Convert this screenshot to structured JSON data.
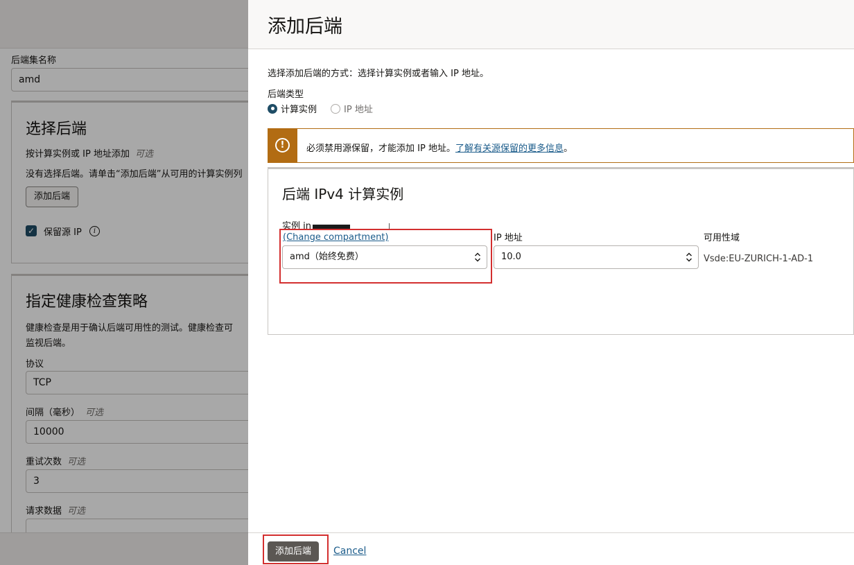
{
  "background": {
    "backend_set_name_label": "后端集名称",
    "backend_set_name_value": "amd",
    "select_backends": {
      "title": "选择后端",
      "add_by_label": "按计算实例或 IP 地址添加",
      "optional": "可选",
      "empty_text": "没有选择后端。请单击“添加后端”从可用的计算实例列",
      "add_button": "添加后端",
      "preserve_source_ip_label": "保留源 IP"
    },
    "health_check": {
      "title": "指定健康检查策略",
      "description_line1": "健康检查是用于确认后端可用性的测试。健康检查可",
      "description_line2": "监视后端。",
      "protocol_label": "协议",
      "protocol_value": "TCP",
      "interval_label": "间隔（毫秒）",
      "interval_value": "10000",
      "retries_label": "重试次数",
      "retries_value": "3",
      "request_data_label": "请求数据",
      "optional": "可选"
    }
  },
  "panel": {
    "title": "添加后端",
    "instructions": "选择添加后端的方式：选择计算实例或者输入 IP 地址。",
    "backend_type_label": "后端类型",
    "backend_type_options": [
      {
        "label": "计算实例",
        "selected": true
      },
      {
        "label": "IP 地址",
        "selected": false
      }
    ],
    "warning": {
      "text": "必须禁用源保留，才能添加 IP 地址。",
      "link": "了解有关源保留的更多信息",
      "suffix": "。",
      "icon": "warning-circle-icon",
      "color": "#b26c13"
    },
    "backend_card": {
      "title": "后端 IPv4 计算实例",
      "instance_label": "实例 in",
      "change_compartment": "(Change compartment)",
      "instance_value": "amd（始终免费）",
      "ip_label": "IP 地址",
      "ip_value": "10.0",
      "ad_label": "可用性域",
      "ad_value": "Vsde:EU-ZURICH-1-AD-1"
    },
    "footer": {
      "add_button": "添加后端",
      "cancel": "Cancel"
    }
  },
  "colors": {
    "accent": "#1f4d66",
    "link": "#1a5b8a",
    "highlight": "#d32f2f",
    "primary_button": "#5b5753"
  }
}
